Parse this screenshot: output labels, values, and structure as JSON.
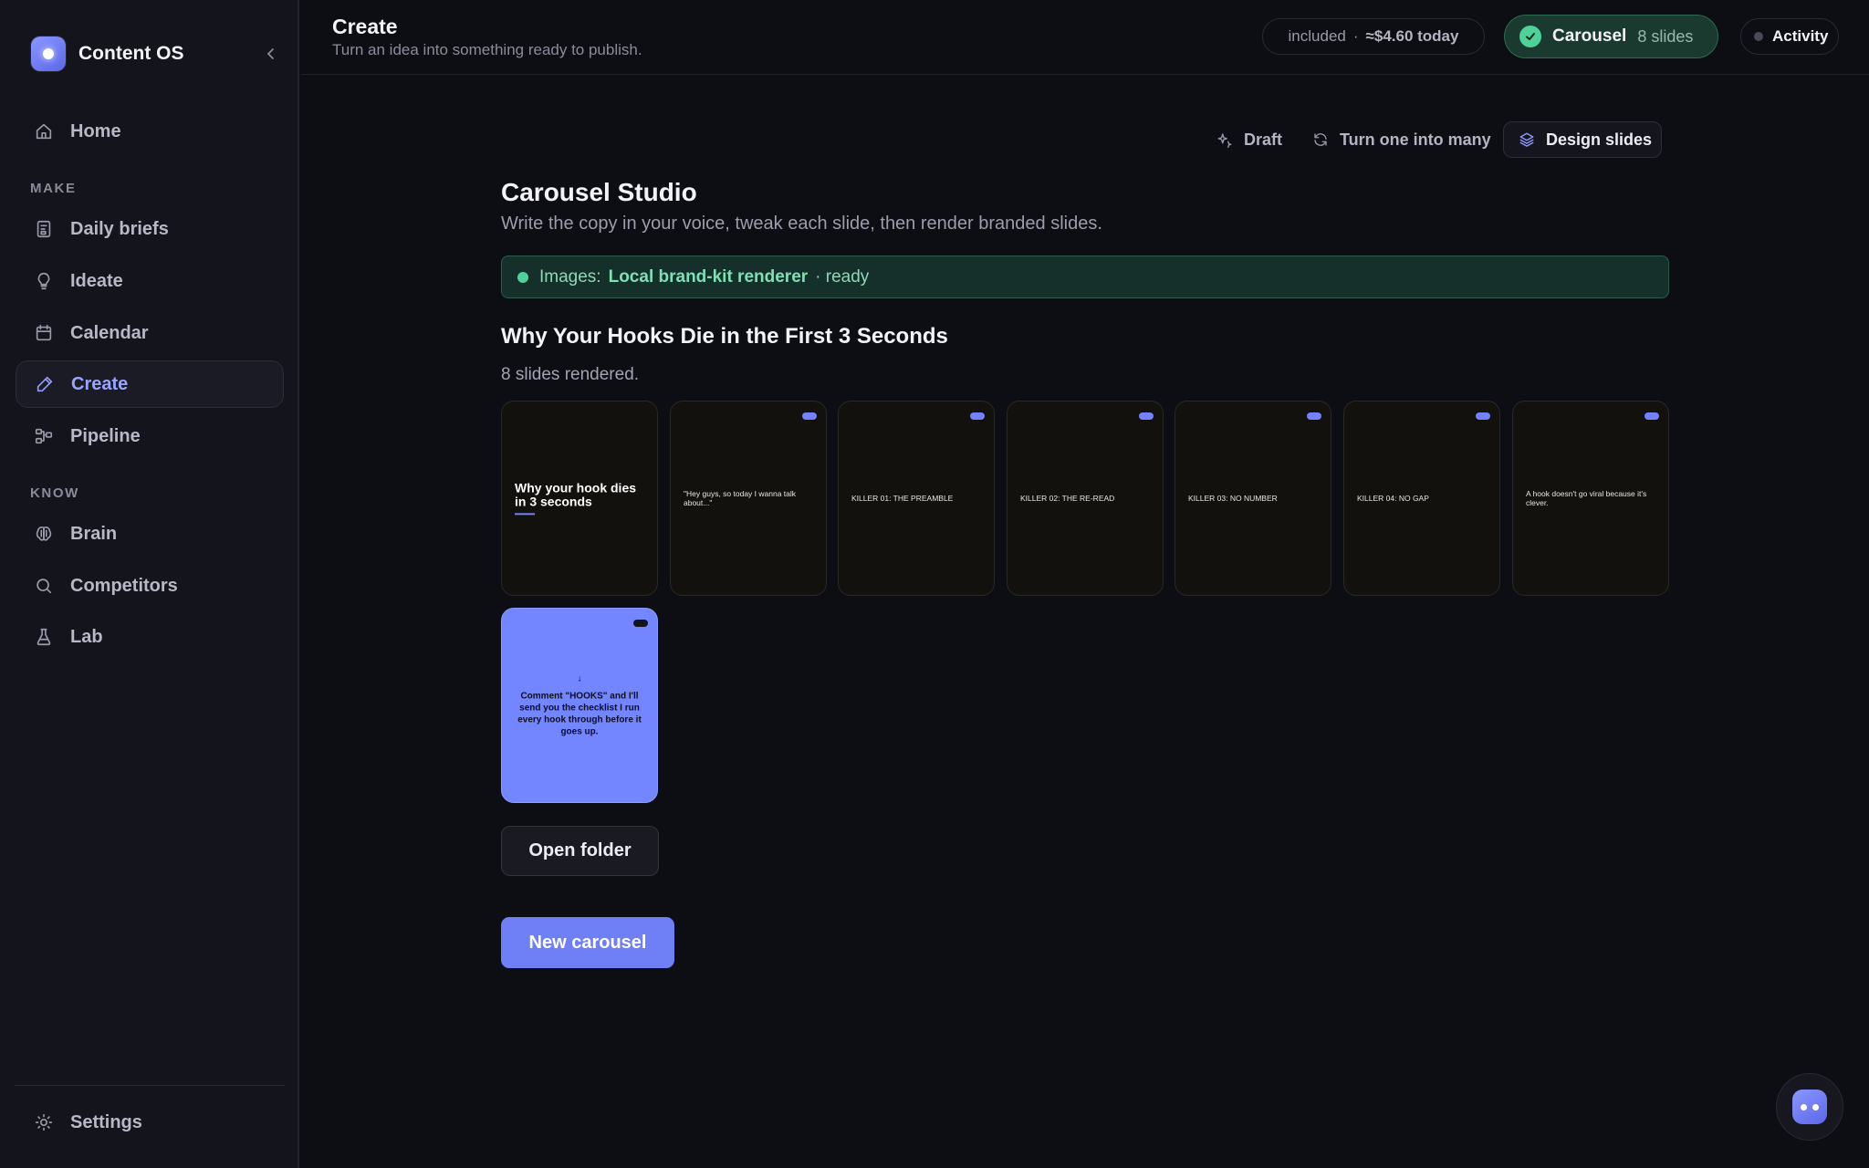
{
  "app": {
    "name": "Content OS"
  },
  "sidebar": {
    "home": "Home",
    "make_label": "MAKE",
    "make_items": [
      "Daily briefs",
      "Ideate",
      "Calendar",
      "Create",
      "Pipeline"
    ],
    "know_label": "KNOW",
    "know_items": [
      "Brain",
      "Competitors",
      "Lab"
    ],
    "settings": "Settings",
    "active": "Create"
  },
  "header": {
    "title": "Create",
    "subtitle": "Turn an idea into something ready to publish.",
    "cost_included": "included",
    "cost_separator": "·",
    "cost_today": "≈$4.60 today",
    "carousel_label": "Carousel",
    "carousel_count": "8 slides",
    "activity": "Activity"
  },
  "toolbar": {
    "draft": "Draft",
    "many": "Turn one into many",
    "design": "Design slides"
  },
  "studio": {
    "title": "Carousel Studio",
    "subtitle": "Write the copy in your voice, tweak each slide, then render branded slides.",
    "banner_prefix": "Images:",
    "banner_renderer": "Local brand-kit renderer",
    "banner_status": "· ready"
  },
  "carousel": {
    "title": "Why Your Hooks Die in the First 3 Seconds",
    "status": "8 slides rendered.",
    "slides": [
      "Why your hook dies in 3 seconds",
      "\"Hey guys, so today I wanna talk about...\"",
      "KILLER 01: THE PREAMBLE",
      "KILLER 02: THE RE-READ",
      "KILLER 03: NO NUMBER",
      "KILLER 04: NO GAP",
      "A hook doesn't go viral because it's clever.",
      "Comment \"HOOKS\" and I'll send you the checklist I run every hook through before it goes up."
    ],
    "cta_arrow": "↓"
  },
  "actions": {
    "open_folder": "Open folder",
    "new_carousel": "New carousel"
  },
  "colors": {
    "accent": "#6f80f6",
    "success": "#4fd19a",
    "background": "#0d0d14",
    "sidebar": "#14141c"
  }
}
